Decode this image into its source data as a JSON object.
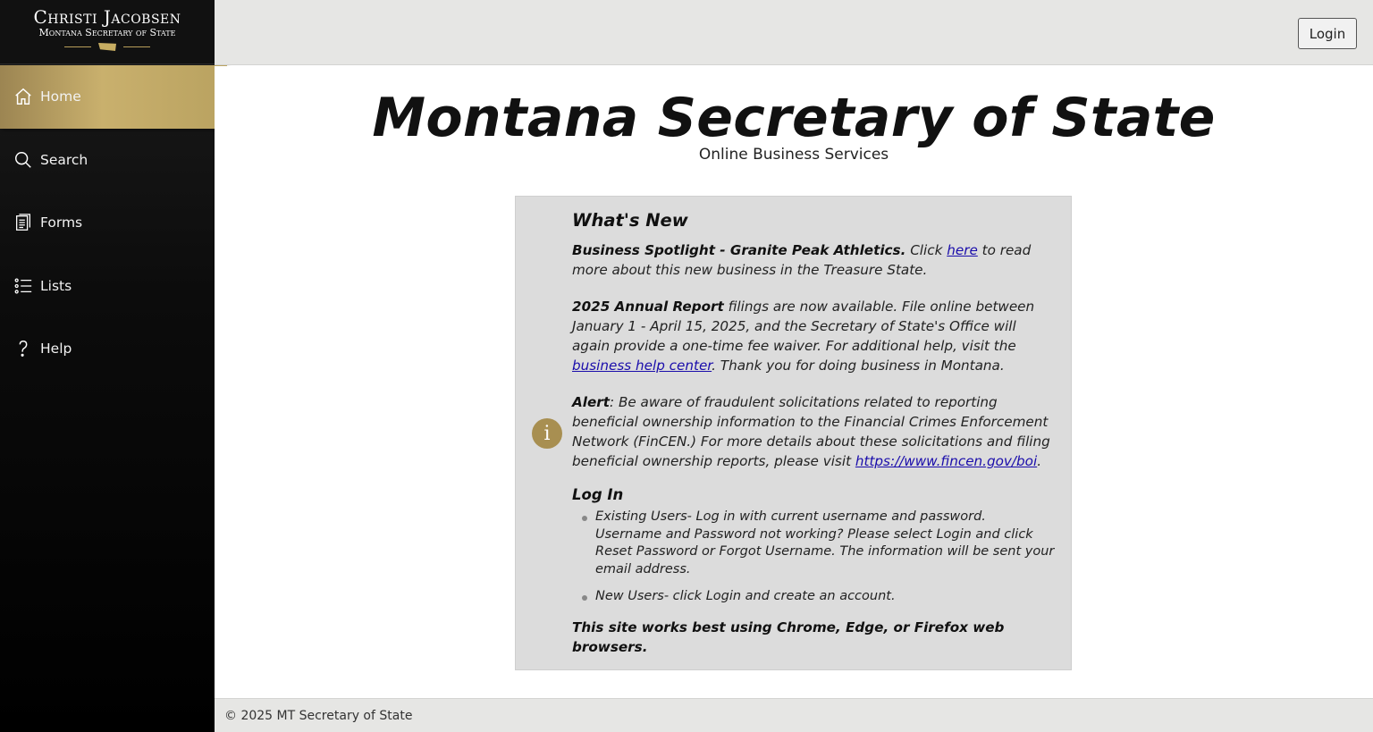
{
  "brand": {
    "name": "Christi Jacobsen",
    "subtitle": "Montana Secretary of State"
  },
  "sidebar": {
    "items": [
      {
        "label": "Home",
        "icon": "home-icon",
        "active": true
      },
      {
        "label": "Search",
        "icon": "search-icon",
        "active": false
      },
      {
        "label": "Forms",
        "icon": "forms-icon",
        "active": false
      },
      {
        "label": "Lists",
        "icon": "list-icon",
        "active": false
      },
      {
        "label": "Help",
        "icon": "help-icon",
        "active": false
      }
    ]
  },
  "topbar": {
    "login_label": "Login"
  },
  "main": {
    "title": "Montana Secretary of State",
    "subtitle": "Online Business Services"
  },
  "news": {
    "heading": "What's New",
    "spotlight_bold": "Business Spotlight - Granite Peak Athletics.",
    "spotlight_pre": " Click ",
    "spotlight_link": "here",
    "spotlight_post": " to read more about this new business in the Treasure State.",
    "annual_bold": "2025 Annual Report",
    "annual_pre": " filings are now available. File online between January 1 - April 15, 2025, and the Secretary of State's Office will again provide a one-time fee waiver. For additional help, visit the ",
    "annual_link": "business help center",
    "annual_post": ". Thank you for doing business in Montana.",
    "alert_bold": "Alert",
    "alert_pre": ": Be aware of fraudulent solicitations related to reporting beneficial ownership information to the Financial Crimes Enforcement Network (FinCEN.) For more details about these solicitations and filing beneficial ownership reports, please visit ",
    "alert_link": "https://www.fincen.gov/boi",
    "alert_post": ".",
    "info_icon_glyph": "i",
    "login_heading": "Log In",
    "login_bullets": [
      "Existing Users- Log in with current username and password. Username and Password not working? Please select Login and click Reset Password or Forgot Username. The information will be sent your email address.",
      "New Users- click Login and create an account."
    ],
    "browsers_note": "This site works best using Chrome, Edge, or Firefox web browsers."
  },
  "footer": {
    "copyright": "© 2025 MT Secretary of State"
  },
  "colors": {
    "accent_gold": "#c9b06d",
    "info_icon": "#a88f51",
    "link": "#1a0dab"
  }
}
